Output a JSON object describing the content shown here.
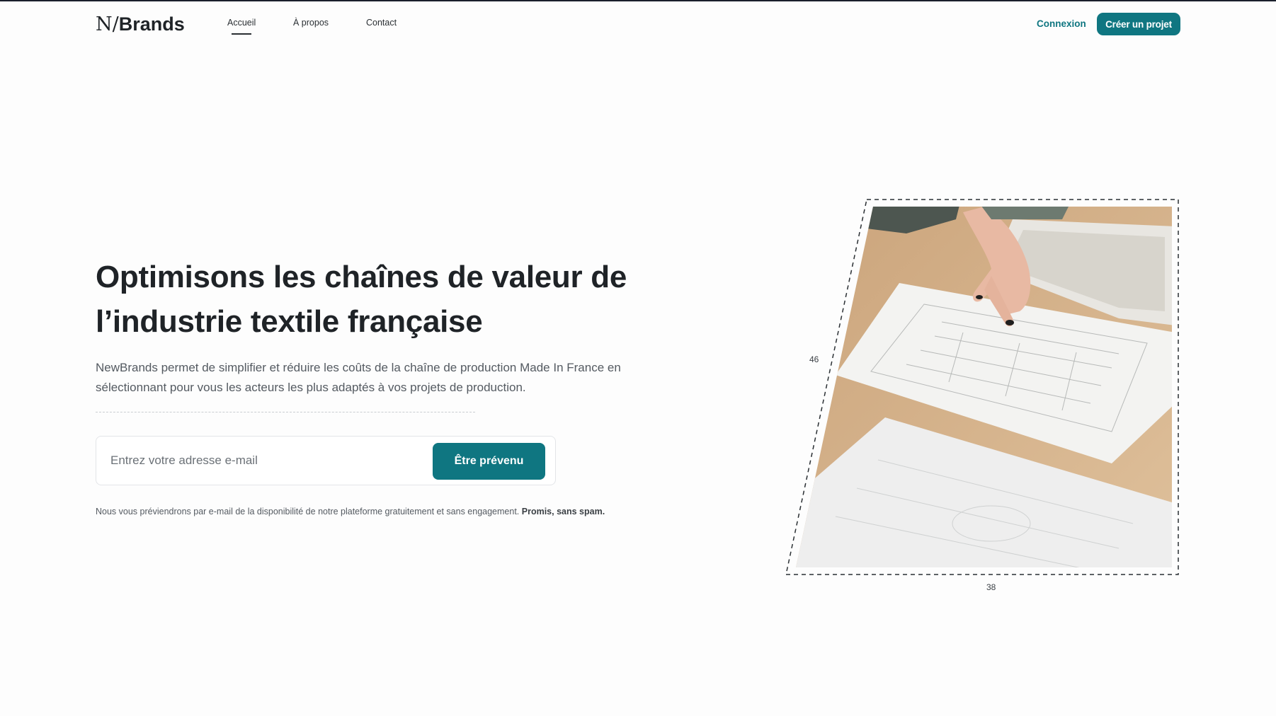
{
  "header": {
    "logo": {
      "mark": "N/",
      "name": "Brands"
    },
    "nav": [
      {
        "label": "Accueil",
        "active": true
      },
      {
        "label": "À propos",
        "active": false
      },
      {
        "label": "Contact",
        "active": false
      }
    ],
    "login_label": "Connexion",
    "cta_label": "Créer un projet"
  },
  "hero": {
    "title": "Optimisons les chaînes de valeur de l’industrie textile française",
    "description": "NewBrands permet de simplifier et réduire les coûts de la chaîne de production Made In France en sélectionnant pour vous les acteurs les plus adaptés à vos projets de production.",
    "email_placeholder": "Entrez votre adresse e-mail",
    "email_value": "",
    "notify_label": "Être prévenu",
    "notice_text": "Nous vous préviendrons par e-mail de la disponibilité de notre plateforme gratuitement et sans engagement.",
    "notice_bold": "Promis, sans spam."
  },
  "illustration": {
    "height_label": "46",
    "width_label": "38"
  },
  "colors": {
    "accent": "#0f7681",
    "text_dark": "#1f2327",
    "text_muted": "#545a61",
    "top_bar": "#1a1f2b"
  }
}
